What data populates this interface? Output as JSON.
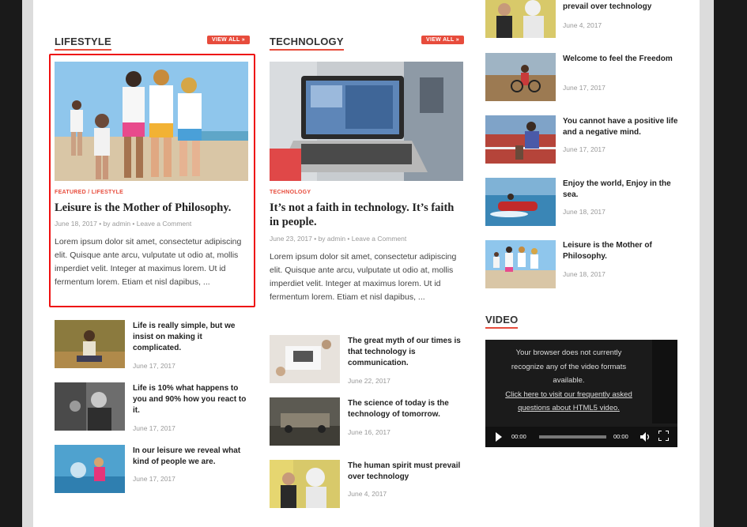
{
  "lifestyle": {
    "heading": "LIFESTYLE",
    "view_all": "VIEW ALL »",
    "featured": {
      "category": "FEATURED / LIFESTYLE",
      "title": "Leisure is the Mother of Philosophy.",
      "meta": "June 18, 2017  •  by admin  •  Leave a Comment",
      "excerpt": "Lorem ipsum dolor sit amet, consectetur adipiscing elit. Quisque ante arcu, vulputate ut odio at, mollis imperdiet velit. Integer at maximus lorem. Ut id fermentum lorem. Etiam et nisl dapibus, ..."
    },
    "list": [
      {
        "title": "Life is really simple, but we insist on making it complicated.",
        "date": "June 17, 2017"
      },
      {
        "title": "Life is 10% what happens to you and 90% how you react to it.",
        "date": "June 17, 2017"
      },
      {
        "title": "In our leisure we reveal what kind of people we are.",
        "date": "June 17, 2017"
      }
    ]
  },
  "technology": {
    "heading": "TECHNOLOGY",
    "view_all": "VIEW ALL »",
    "featured": {
      "category": "TECHNOLOGY",
      "title": "It’s not a faith in technology. It’s faith in people.",
      "meta": "June 23, 2017  •  by admin  •  Leave a Comment",
      "excerpt": "Lorem ipsum dolor sit amet, consectetur adipiscing elit. Quisque ante arcu, vulputate ut odio at, mollis imperdiet velit. Integer at maximus lorem. Ut id fermentum lorem. Etiam et nisl dapibus, ..."
    },
    "list": [
      {
        "title": "The great myth of our times is that technology is communication.",
        "date": "June 22, 2017"
      },
      {
        "title": "The science of today is the technology of tomorrow.",
        "date": "June 16, 2017"
      },
      {
        "title": "The human spirit must prevail over technology",
        "date": "June 4, 2017"
      }
    ]
  },
  "sidebar": {
    "posts": [
      {
        "title": "prevail over technology",
        "date": "June 4, 2017"
      },
      {
        "title": "Welcome to feel the Freedom",
        "date": "June 17, 2017"
      },
      {
        "title": "You cannot have a positive life and a negative mind.",
        "date": "June 17, 2017"
      },
      {
        "title": "Enjoy the world, Enjoy in the sea.",
        "date": "June 18, 2017"
      },
      {
        "title": "Leisure is the Mother of Philosophy.",
        "date": "June 18, 2017"
      }
    ],
    "video_heading": "VIDEO",
    "video": {
      "message_1": "Your browser does not currently",
      "message_2": "recognize any of the video formats",
      "message_3": "available.",
      "link_1": "Click here to visit our frequently asked",
      "link_2": "questions about HTML5 video.",
      "time_current": "00:00",
      "time_total": "00:00"
    }
  },
  "colors": {
    "accent": "#e74c3c",
    "highlight": "#e11111"
  }
}
